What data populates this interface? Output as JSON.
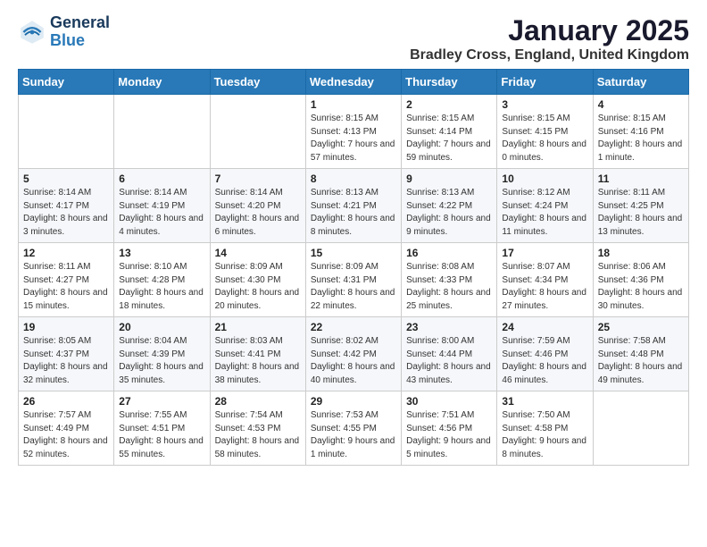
{
  "header": {
    "logo_line1": "General",
    "logo_line2": "Blue",
    "month_title": "January 2025",
    "location": "Bradley Cross, England, United Kingdom"
  },
  "weekdays": [
    "Sunday",
    "Monday",
    "Tuesday",
    "Wednesday",
    "Thursday",
    "Friday",
    "Saturday"
  ],
  "weeks": [
    [
      {
        "day": "",
        "info": ""
      },
      {
        "day": "",
        "info": ""
      },
      {
        "day": "",
        "info": ""
      },
      {
        "day": "1",
        "info": "Sunrise: 8:15 AM\nSunset: 4:13 PM\nDaylight: 7 hours and 57 minutes."
      },
      {
        "day": "2",
        "info": "Sunrise: 8:15 AM\nSunset: 4:14 PM\nDaylight: 7 hours and 59 minutes."
      },
      {
        "day": "3",
        "info": "Sunrise: 8:15 AM\nSunset: 4:15 PM\nDaylight: 8 hours and 0 minutes."
      },
      {
        "day": "4",
        "info": "Sunrise: 8:15 AM\nSunset: 4:16 PM\nDaylight: 8 hours and 1 minute."
      }
    ],
    [
      {
        "day": "5",
        "info": "Sunrise: 8:14 AM\nSunset: 4:17 PM\nDaylight: 8 hours and 3 minutes."
      },
      {
        "day": "6",
        "info": "Sunrise: 8:14 AM\nSunset: 4:19 PM\nDaylight: 8 hours and 4 minutes."
      },
      {
        "day": "7",
        "info": "Sunrise: 8:14 AM\nSunset: 4:20 PM\nDaylight: 8 hours and 6 minutes."
      },
      {
        "day": "8",
        "info": "Sunrise: 8:13 AM\nSunset: 4:21 PM\nDaylight: 8 hours and 8 minutes."
      },
      {
        "day": "9",
        "info": "Sunrise: 8:13 AM\nSunset: 4:22 PM\nDaylight: 8 hours and 9 minutes."
      },
      {
        "day": "10",
        "info": "Sunrise: 8:12 AM\nSunset: 4:24 PM\nDaylight: 8 hours and 11 minutes."
      },
      {
        "day": "11",
        "info": "Sunrise: 8:11 AM\nSunset: 4:25 PM\nDaylight: 8 hours and 13 minutes."
      }
    ],
    [
      {
        "day": "12",
        "info": "Sunrise: 8:11 AM\nSunset: 4:27 PM\nDaylight: 8 hours and 15 minutes."
      },
      {
        "day": "13",
        "info": "Sunrise: 8:10 AM\nSunset: 4:28 PM\nDaylight: 8 hours and 18 minutes."
      },
      {
        "day": "14",
        "info": "Sunrise: 8:09 AM\nSunset: 4:30 PM\nDaylight: 8 hours and 20 minutes."
      },
      {
        "day": "15",
        "info": "Sunrise: 8:09 AM\nSunset: 4:31 PM\nDaylight: 8 hours and 22 minutes."
      },
      {
        "day": "16",
        "info": "Sunrise: 8:08 AM\nSunset: 4:33 PM\nDaylight: 8 hours and 25 minutes."
      },
      {
        "day": "17",
        "info": "Sunrise: 8:07 AM\nSunset: 4:34 PM\nDaylight: 8 hours and 27 minutes."
      },
      {
        "day": "18",
        "info": "Sunrise: 8:06 AM\nSunset: 4:36 PM\nDaylight: 8 hours and 30 minutes."
      }
    ],
    [
      {
        "day": "19",
        "info": "Sunrise: 8:05 AM\nSunset: 4:37 PM\nDaylight: 8 hours and 32 minutes."
      },
      {
        "day": "20",
        "info": "Sunrise: 8:04 AM\nSunset: 4:39 PM\nDaylight: 8 hours and 35 minutes."
      },
      {
        "day": "21",
        "info": "Sunrise: 8:03 AM\nSunset: 4:41 PM\nDaylight: 8 hours and 38 minutes."
      },
      {
        "day": "22",
        "info": "Sunrise: 8:02 AM\nSunset: 4:42 PM\nDaylight: 8 hours and 40 minutes."
      },
      {
        "day": "23",
        "info": "Sunrise: 8:00 AM\nSunset: 4:44 PM\nDaylight: 8 hours and 43 minutes."
      },
      {
        "day": "24",
        "info": "Sunrise: 7:59 AM\nSunset: 4:46 PM\nDaylight: 8 hours and 46 minutes."
      },
      {
        "day": "25",
        "info": "Sunrise: 7:58 AM\nSunset: 4:48 PM\nDaylight: 8 hours and 49 minutes."
      }
    ],
    [
      {
        "day": "26",
        "info": "Sunrise: 7:57 AM\nSunset: 4:49 PM\nDaylight: 8 hours and 52 minutes."
      },
      {
        "day": "27",
        "info": "Sunrise: 7:55 AM\nSunset: 4:51 PM\nDaylight: 8 hours and 55 minutes."
      },
      {
        "day": "28",
        "info": "Sunrise: 7:54 AM\nSunset: 4:53 PM\nDaylight: 8 hours and 58 minutes."
      },
      {
        "day": "29",
        "info": "Sunrise: 7:53 AM\nSunset: 4:55 PM\nDaylight: 9 hours and 1 minute."
      },
      {
        "day": "30",
        "info": "Sunrise: 7:51 AM\nSunset: 4:56 PM\nDaylight: 9 hours and 5 minutes."
      },
      {
        "day": "31",
        "info": "Sunrise: 7:50 AM\nSunset: 4:58 PM\nDaylight: 9 hours and 8 minutes."
      },
      {
        "day": "",
        "info": ""
      }
    ]
  ]
}
